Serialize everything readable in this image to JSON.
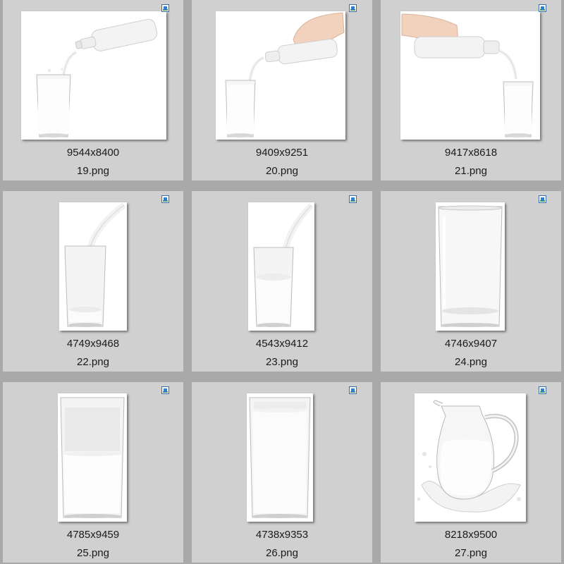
{
  "files": [
    {
      "dimensions": "9544x8400",
      "name": "19.png",
      "icon": "image-file-icon",
      "thumbnail": "milk-bottle-pouring-into-glass"
    },
    {
      "dimensions": "9409x9251",
      "name": "20.png",
      "icon": "image-file-icon",
      "thumbnail": "hand-pouring-milk-bottle-into-glass"
    },
    {
      "dimensions": "9417x8618",
      "name": "21.png",
      "icon": "image-file-icon",
      "thumbnail": "hand-pouring-milk-bottle-into-glass-right"
    },
    {
      "dimensions": "4749x9468",
      "name": "22.png",
      "icon": "image-file-icon",
      "thumbnail": "milk-stream-into-empty-glass"
    },
    {
      "dimensions": "4543x9412",
      "name": "23.png",
      "icon": "image-file-icon",
      "thumbnail": "milk-stream-into-half-glass"
    },
    {
      "dimensions": "4746x9407",
      "name": "24.png",
      "icon": "image-file-icon",
      "thumbnail": "empty-glass"
    },
    {
      "dimensions": "4785x9459",
      "name": "25.png",
      "icon": "image-file-icon",
      "thumbnail": "half-full-milk-glass"
    },
    {
      "dimensions": "4738x9353",
      "name": "26.png",
      "icon": "image-file-icon",
      "thumbnail": "full-milk-glass"
    },
    {
      "dimensions": "8218x9500",
      "name": "27.png",
      "icon": "image-file-icon",
      "thumbnail": "milk-jug-with-splash"
    }
  ],
  "colors": {
    "background": "#a9a9a9",
    "tile": "#d0d0d0",
    "thumbnail_background": "#ffffff"
  }
}
